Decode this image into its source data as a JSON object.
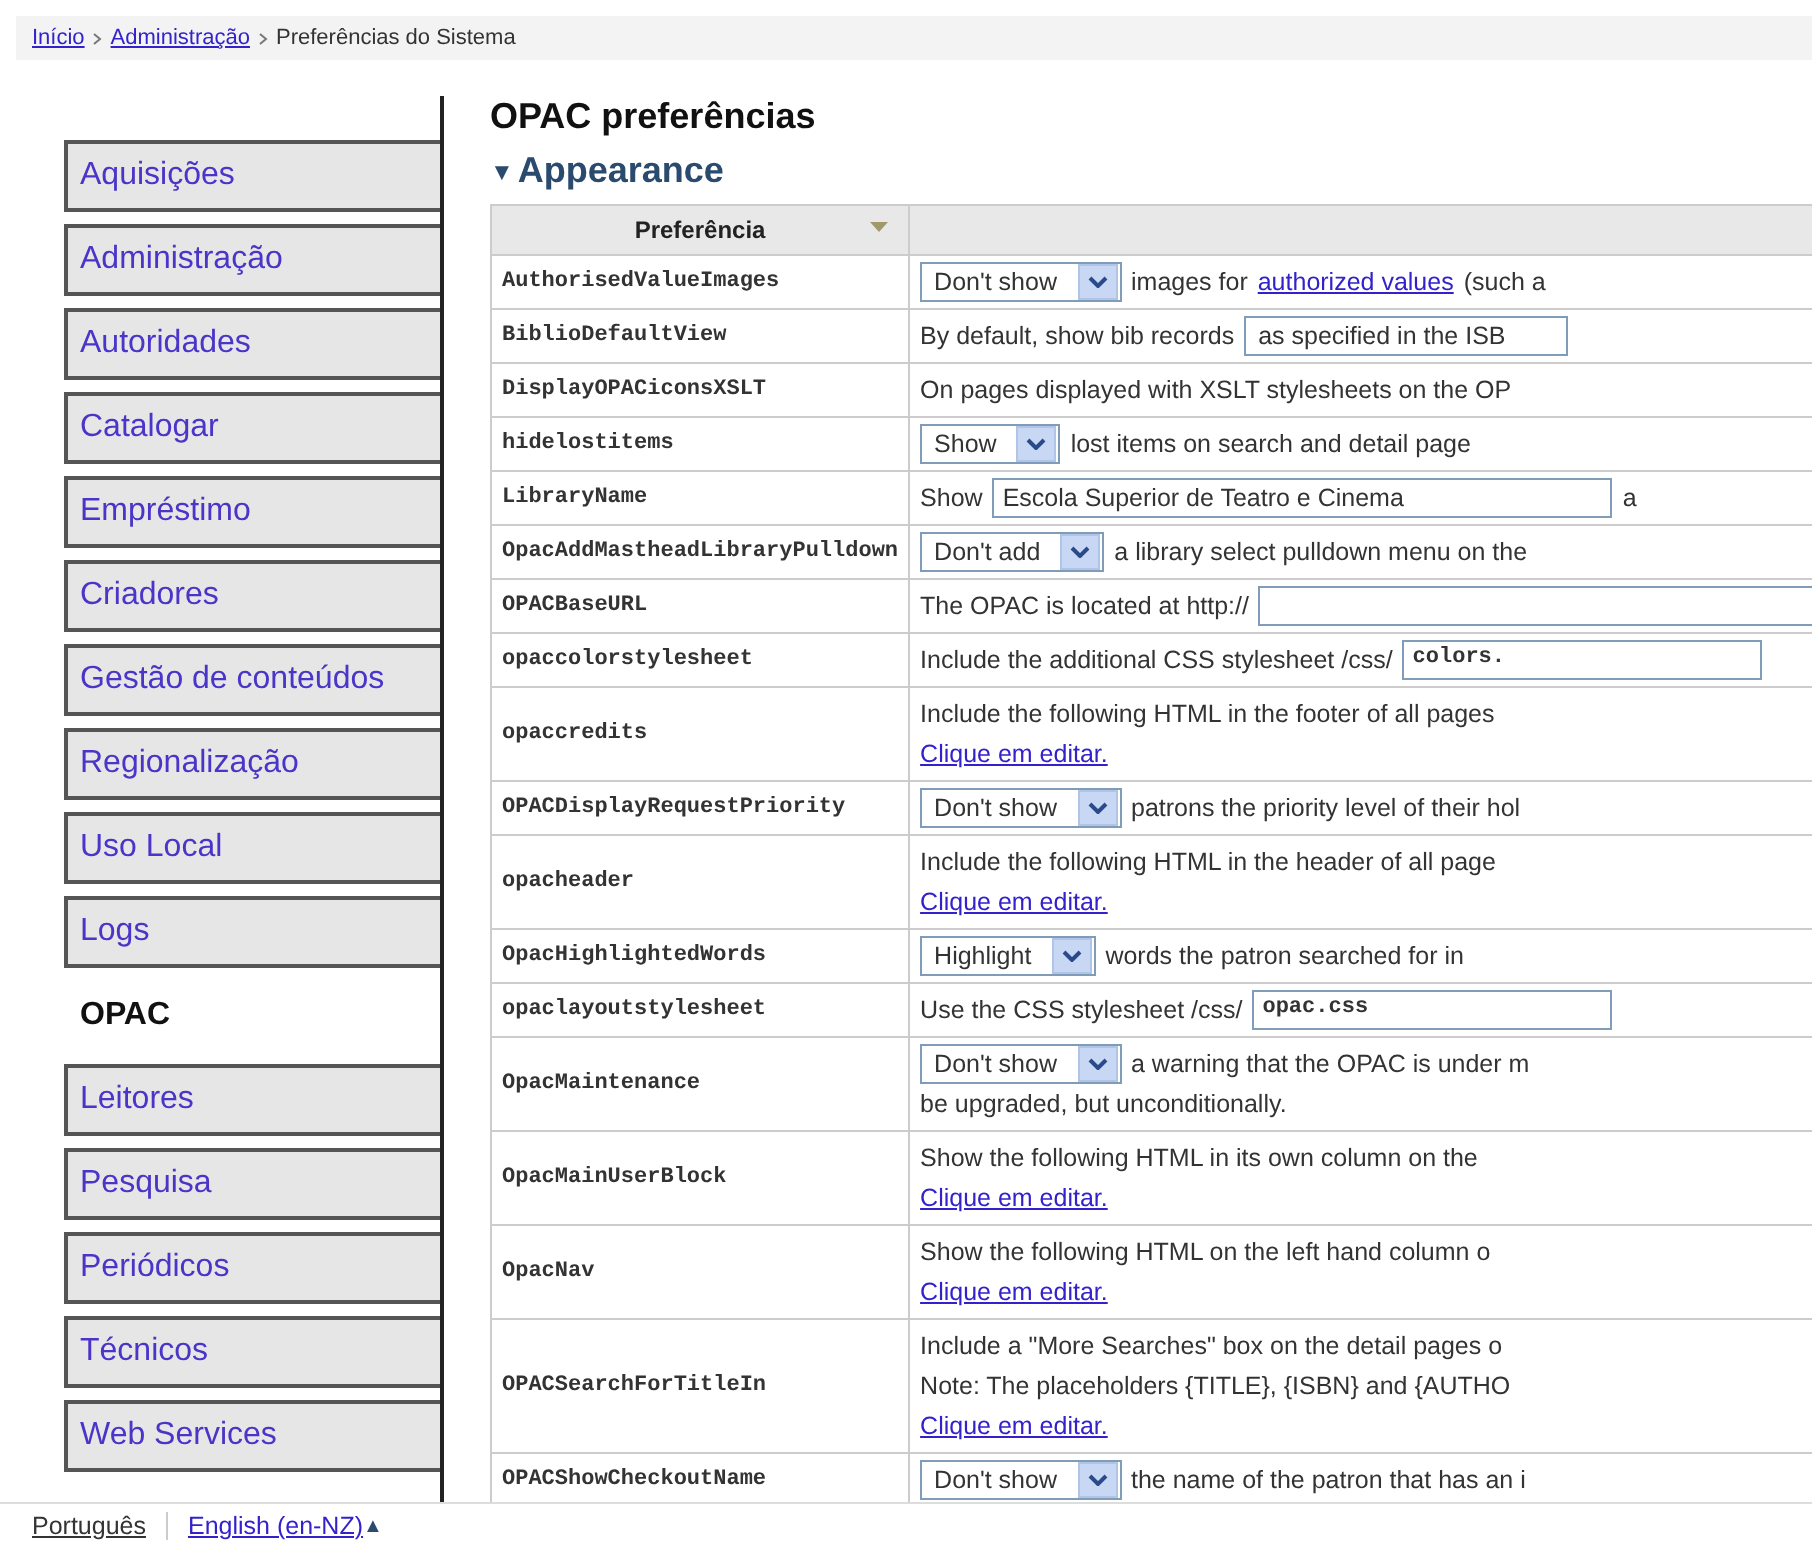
{
  "breadcrumb": [
    {
      "text": "Início",
      "kind": "link"
    },
    {
      "text": "Administração",
      "kind": "link"
    },
    {
      "text": "Preferências do Sistema",
      "kind": "text"
    }
  ],
  "sidebar": {
    "items": [
      {
        "label": "Aquisições",
        "selected": false
      },
      {
        "label": "Administração",
        "selected": false
      },
      {
        "label": "Autoridades",
        "selected": false
      },
      {
        "label": "Catalogar",
        "selected": false
      },
      {
        "label": "Empréstimo",
        "selected": false
      },
      {
        "label": "Criadores",
        "selected": false
      },
      {
        "label": "Gestão de conteúdos",
        "selected": false
      },
      {
        "label": "Regionalização",
        "selected": false
      },
      {
        "label": "Uso Local",
        "selected": false
      },
      {
        "label": "Logs",
        "selected": false
      },
      {
        "label": "OPAC",
        "selected": true
      },
      {
        "label": "Leitores",
        "selected": false
      },
      {
        "label": "Pesquisa",
        "selected": false
      },
      {
        "label": "Periódicos",
        "selected": false
      },
      {
        "label": "Técnicos",
        "selected": false
      },
      {
        "label": "Web Services",
        "selected": false
      }
    ]
  },
  "title": "OPAC preferências",
  "section": {
    "toggle": "▼",
    "title": "Appearance",
    "expanded": true
  },
  "table": {
    "columns": [
      "Preferência"
    ],
    "rows": [
      {
        "name": "AuthorisedValueImages",
        "lines": [
          [
            {
              "kind": "select",
              "value": "Don't show"
            },
            {
              "kind": "text",
              "text": "images for"
            },
            {
              "kind": "link",
              "text": "authorized values"
            },
            {
              "kind": "text",
              "text": "(such a"
            }
          ]
        ]
      },
      {
        "name": "BiblioDefaultView",
        "lines": [
          [
            {
              "kind": "text",
              "text": "By default, show bib records"
            },
            {
              "kind": "select",
              "value": "as specified in the ISB",
              "arrow": false
            }
          ]
        ]
      },
      {
        "name": "DisplayOPACiconsXSLT",
        "lines": [
          [
            {
              "kind": "text",
              "text": "On pages displayed with XSLT stylesheets on the OP"
            }
          ]
        ]
      },
      {
        "name": "hidelostitems",
        "lines": [
          [
            {
              "kind": "select",
              "value": "Show"
            },
            {
              "kind": "text",
              "text": "lost items on search and detail page"
            }
          ]
        ]
      },
      {
        "name": "LibraryName",
        "lines": [
          [
            {
              "kind": "text",
              "text": "Show"
            },
            {
              "kind": "input",
              "value": "Escola Superior de Teatro e Cinema"
            },
            {
              "kind": "text",
              "text": "a"
            }
          ]
        ]
      },
      {
        "name": "OpacAddMastheadLibraryPulldown",
        "lines": [
          [
            {
              "kind": "select",
              "value": "Don't add"
            },
            {
              "kind": "text",
              "text": "a library select pulldown menu on the"
            }
          ]
        ]
      },
      {
        "name": "OPACBaseURL",
        "lines": [
          [
            {
              "kind": "text",
              "text": "The OPAC is located at http://"
            },
            {
              "kind": "input"
            }
          ]
        ]
      },
      {
        "name": "opaccolorstylesheet",
        "lines": [
          [
            {
              "kind": "text",
              "text": "Include the additional CSS stylesheet /css/"
            },
            {
              "kind": "code_input",
              "value": "colors."
            }
          ]
        ]
      },
      {
        "name": "opaccredits",
        "lines": [
          [
            {
              "kind": "text",
              "text": "Include the following HTML in the footer of all pages"
            }
          ],
          [
            {
              "kind": "link",
              "text": "Clique em editar."
            }
          ]
        ]
      },
      {
        "name": "OPACDisplayRequestPriority",
        "lines": [
          [
            {
              "kind": "select",
              "value": "Don't show"
            },
            {
              "kind": "text",
              "text": "patrons the priority level of their hol"
            }
          ]
        ]
      },
      {
        "name": "opacheader",
        "lines": [
          [
            {
              "kind": "text",
              "text": "Include the following HTML in the header of all page"
            }
          ],
          [
            {
              "kind": "link",
              "text": "Clique em editar."
            }
          ]
        ]
      },
      {
        "name": "OpacHighlightedWords",
        "lines": [
          [
            {
              "kind": "select",
              "value": "Highlight"
            },
            {
              "kind": "text",
              "text": "words the patron searched for in"
            }
          ]
        ]
      },
      {
        "name": "opaclayoutstylesheet",
        "lines": [
          [
            {
              "kind": "text",
              "text": "Use the CSS stylesheet /css/"
            },
            {
              "kind": "code_input",
              "value": "opac.css"
            }
          ]
        ]
      },
      {
        "name": "OpacMaintenance",
        "lines": [
          [
            {
              "kind": "select",
              "value": "Don't show"
            },
            {
              "kind": "text",
              "text": "a warning that the OPAC is under m"
            }
          ],
          [
            {
              "kind": "text",
              "text": "be upgraded, but unconditionally."
            }
          ]
        ]
      },
      {
        "name": "OpacMainUserBlock",
        "lines": [
          [
            {
              "kind": "text",
              "text": "Show the following HTML in its own column on the"
            }
          ],
          [
            {
              "kind": "link",
              "text": "Clique em editar."
            }
          ]
        ]
      },
      {
        "name": "OpacNav",
        "lines": [
          [
            {
              "kind": "text",
              "text": "Show the following HTML on the left hand column o"
            }
          ],
          [
            {
              "kind": "link",
              "text": "Clique em editar."
            }
          ]
        ]
      },
      {
        "name": "OPACSearchForTitleIn",
        "lines": [
          [
            {
              "kind": "text",
              "text": "Include a \"More Searches\" box on the detail pages o"
            }
          ],
          [
            {
              "kind": "text",
              "text": "Note: The placeholders {TITLE}, {ISBN} and {AUTHO"
            }
          ],
          [
            {
              "kind": "link",
              "text": "Clique em editar."
            }
          ]
        ]
      },
      {
        "name": "OPACShowCheckoutName",
        "lines": [
          [
            {
              "kind": "select",
              "value": "Don't show"
            },
            {
              "kind": "text",
              "text": "the name of the patron that has an i"
            }
          ]
        ]
      }
    ]
  },
  "languages": [
    {
      "label": "Português",
      "selected": true
    },
    {
      "label": "English (en-NZ)",
      "selected": false,
      "caret": "▲"
    }
  ]
}
